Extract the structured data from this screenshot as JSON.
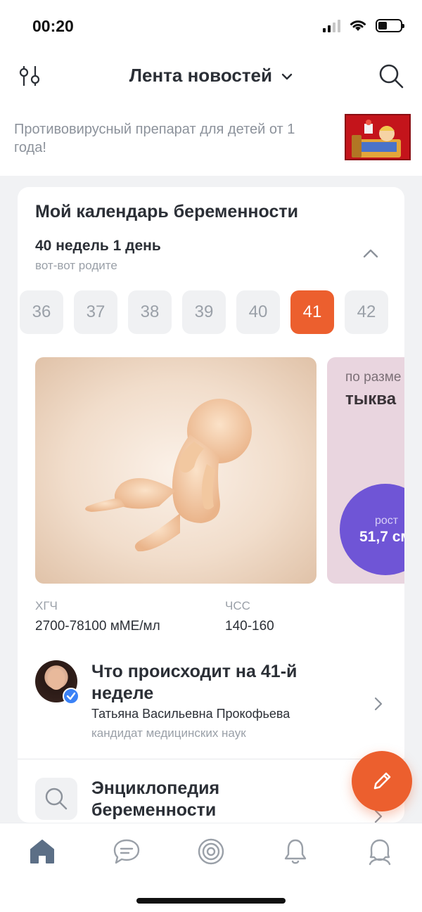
{
  "status_bar": {
    "time": "00:20"
  },
  "header": {
    "title": "Лента новостей"
  },
  "ad": {
    "text": "Противовирусный препарат для детей от 1 года!"
  },
  "calendar": {
    "title": "Мой календарь беременности",
    "week_title": "40 недель 1 день",
    "week_subtitle": "вот-вот родите",
    "weeks": [
      "36",
      "37",
      "38",
      "39",
      "40",
      "41",
      "42"
    ],
    "active_week": "41",
    "size_card": {
      "label": "по разме",
      "fruit": "тыква",
      "height_label": "рост",
      "height_value": "51,7 см"
    },
    "metrics": [
      {
        "label": "ХГЧ",
        "value": "2700-78100 мМЕ/мл"
      },
      {
        "label": "ЧСС",
        "value": "140-160"
      }
    ],
    "article": {
      "title": "Что происходит на 41-й неделе",
      "author": "Татьяна Васильевна Прокофьева",
      "degree": "кандидат медицинских наук"
    },
    "encyclopedia": {
      "title": "Энциклопедия беременности"
    }
  },
  "colors": {
    "accent": "#ec5f2e",
    "height_circle": "#6f55d6",
    "size_card_bg": "#e9d5df",
    "verified": "#3b82f6"
  },
  "tabs": [
    {
      "name": "home",
      "icon": "home-icon"
    },
    {
      "name": "chat",
      "icon": "chat-icon"
    },
    {
      "name": "target",
      "icon": "target-icon"
    },
    {
      "name": "notifications",
      "icon": "bell-icon"
    },
    {
      "name": "profile",
      "icon": "user-icon"
    }
  ]
}
